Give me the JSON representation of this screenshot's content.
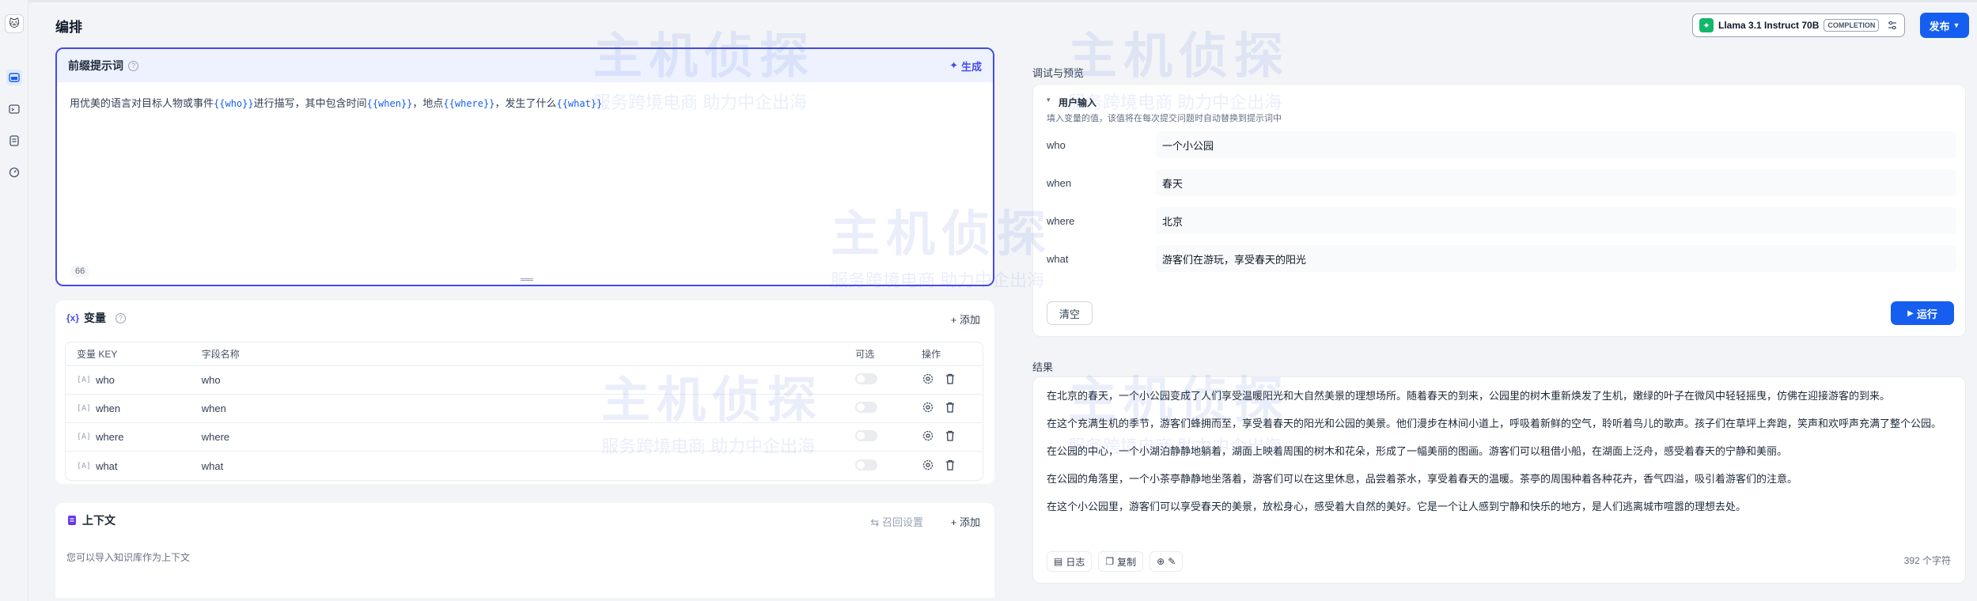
{
  "header": {
    "title": "编排",
    "model_name": "Llama 3.1 Instruct 70B",
    "model_mode": "COMPLETION",
    "publish_label": "发布"
  },
  "prompt": {
    "title": "前缀提示词",
    "generate_label": "生成",
    "text_before": "用优美的语言对目标人物或事件",
    "var_who": "{{who}}",
    "text_mid1": "进行描写，其中包含时间",
    "var_when": "{{when}}",
    "text_mid2": "，地点",
    "var_where": "{{where}}",
    "text_mid3": "，发生了什么",
    "var_what": "{{what}}",
    "char_count": "66"
  },
  "variables": {
    "title": "变量",
    "icon": "{x}",
    "add_label": "添加",
    "columns": {
      "key": "变量 KEY",
      "name": "字段名称",
      "optional": "可选",
      "actions": "操作"
    },
    "rows": [
      {
        "key": "who",
        "name": "who"
      },
      {
        "key": "when",
        "name": "when"
      },
      {
        "key": "where",
        "name": "where"
      },
      {
        "key": "what",
        "name": "what"
      }
    ]
  },
  "context": {
    "title": "上下文",
    "settings_label": "召回设置",
    "add_label": "添加",
    "description": "您可以导入知识库作为上下文"
  },
  "debug": {
    "title": "调试与预览",
    "user_input_title": "用户输入",
    "user_input_desc": "填入变量的值，该值将在每次提交问题时自动替换到提示词中",
    "fields": [
      {
        "label": "who",
        "value": "一个小公园"
      },
      {
        "label": "when",
        "value": "春天"
      },
      {
        "label": "where",
        "value": "北京"
      },
      {
        "label": "what",
        "value": "游客们在游玩，享受春天的阳光"
      }
    ],
    "clear_label": "清空",
    "run_label": "运行"
  },
  "result": {
    "title": "结果",
    "paragraphs": [
      "在北京的春天，一个小公园变成了人们享受温暖阳光和大自然美景的理想场所。随着春天的到来，公园里的树木重新焕发了生机，嫩绿的叶子在微风中轻轻摇曳，仿佛在迎接游客的到来。",
      "在这个充满生机的季节，游客们蜂拥而至，享受着春天的阳光和公园的美景。他们漫步在林间小道上，呼吸着新鲜的空气，聆听着鸟儿的歌声。孩子们在草坪上奔跑，笑声和欢呼声充满了整个公园。",
      "在公园的中心，一个小湖泊静静地躺着，湖面上映着周围的树木和花朵，形成了一幅美丽的图画。游客们可以租借小船，在湖面上泛舟，感受着春天的宁静和美丽。",
      "在公园的角落里，一个小茶亭静静地坐落着，游客们可以在这里休息，品尝着茶水，享受着春天的温暖。茶亭的周围种着各种花卉，香气四溢，吸引着游客们的注意。",
      "在这个小公园里，游客们可以享受春天的美景，放松身心，感受着大自然的美好。它是一个让人感到宁静和快乐的地方，是人们逃离城市喧嚣的理想去处。"
    ],
    "log_label": "日志",
    "copy_label": "复制",
    "char_count": "392 个字符"
  },
  "watermark": {
    "main": "主机侦探",
    "sub": "服务跨境电商 助力中企出海"
  },
  "colors": {
    "accent": "#155eef",
    "prompt_border": "#444ce7",
    "prompt_header": "#eef2ff",
    "model_logo": "#12b76a"
  }
}
